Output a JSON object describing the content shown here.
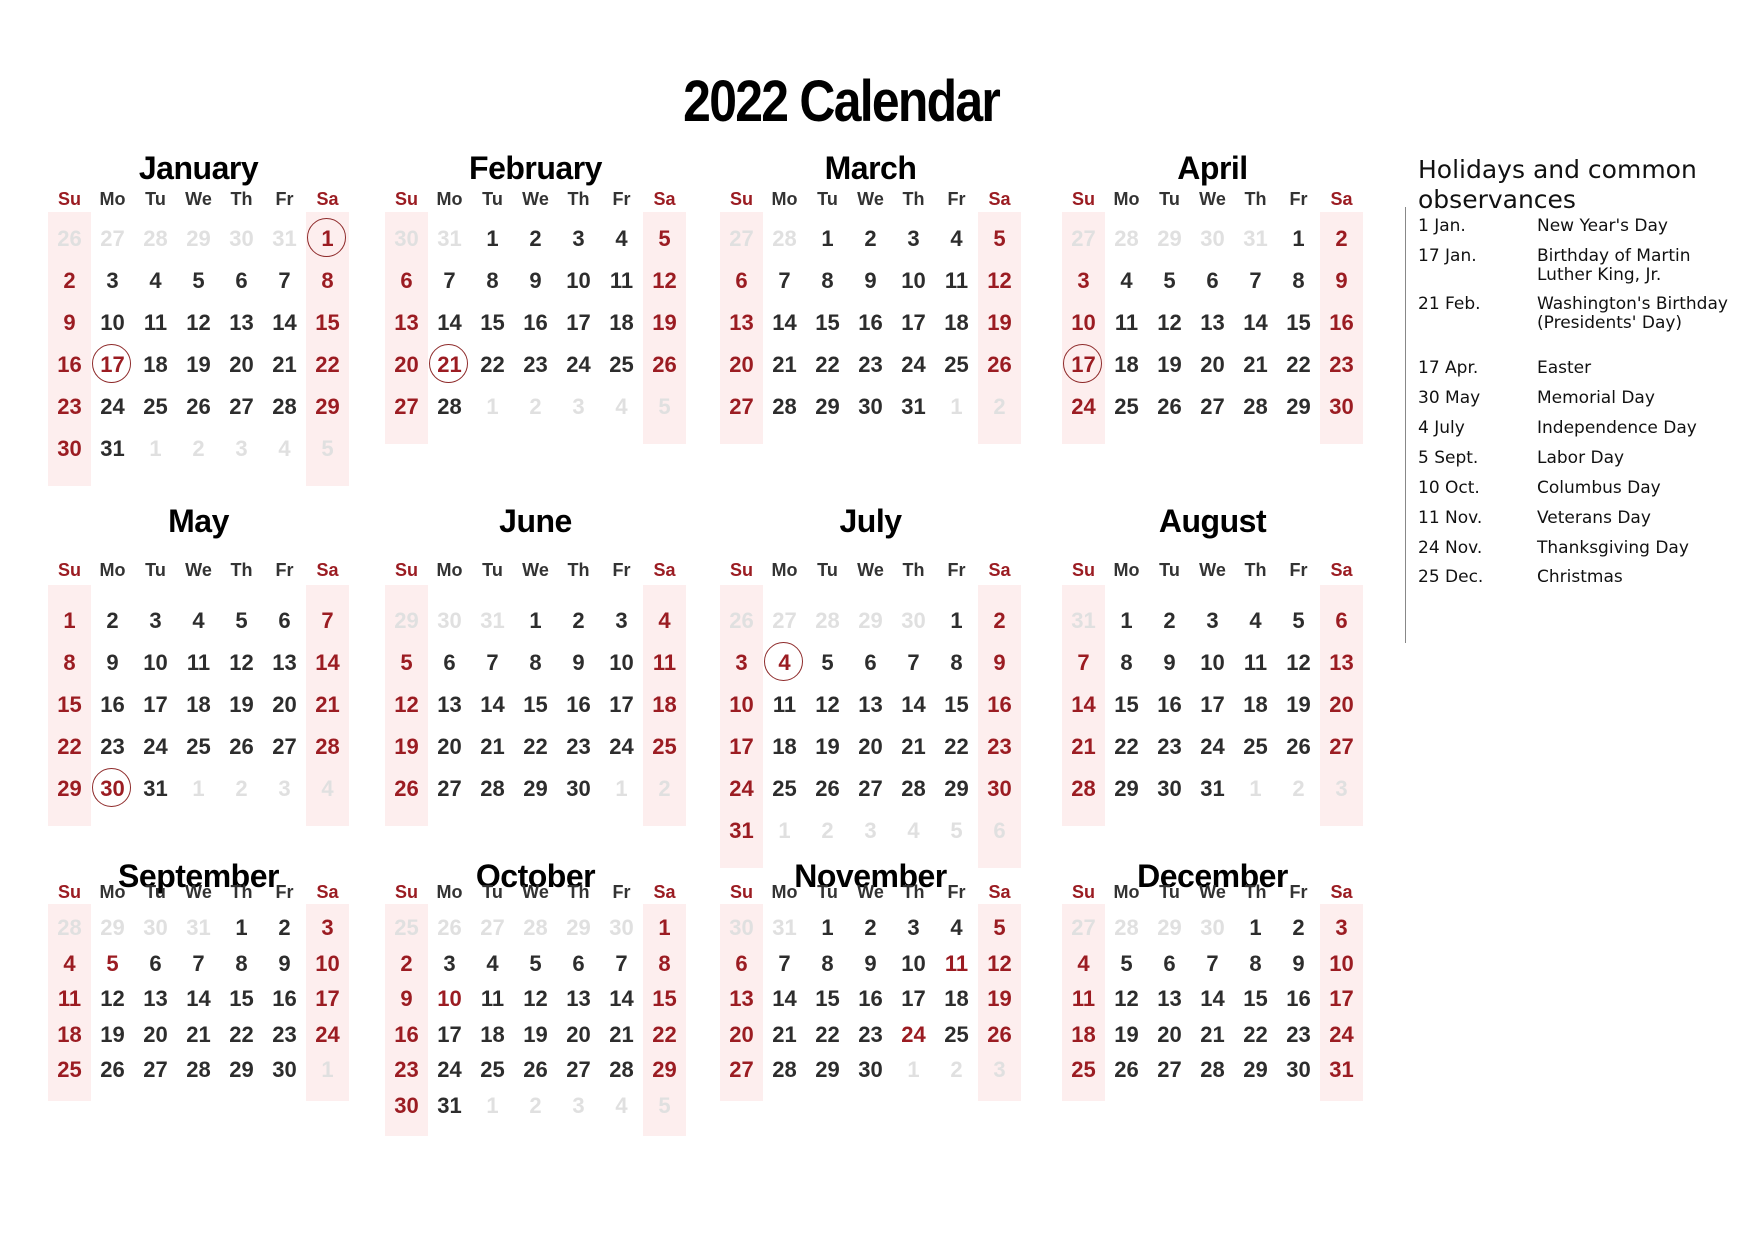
{
  "title": "2022 Calendar",
  "weekdays": [
    "Su",
    "Mo",
    "Tu",
    "We",
    "Th",
    "Fr",
    "Sa"
  ],
  "colors": {
    "weekend": "#9b1c22",
    "band": "#fdeeee",
    "other_month": "#e0e0e0",
    "text": "#2d2d2d"
  },
  "months": [
    {
      "name": "January",
      "lead": [
        26,
        27,
        28,
        29,
        30,
        31
      ],
      "days": 31,
      "trail": [
        1,
        2,
        3,
        4,
        5
      ],
      "circled": [
        1,
        17
      ],
      "holidays": [
        1,
        17
      ]
    },
    {
      "name": "February",
      "lead": [
        30,
        31
      ],
      "days": 28,
      "trail": [
        1,
        2,
        3,
        4,
        5
      ],
      "circled": [
        21
      ],
      "holidays": [
        21
      ]
    },
    {
      "name": "March",
      "lead": [
        27,
        28
      ],
      "days": 31,
      "trail": [
        1,
        2
      ],
      "circled": [],
      "holidays": []
    },
    {
      "name": "April",
      "lead": [
        27,
        28,
        29,
        30,
        31
      ],
      "days": 30,
      "trail": [],
      "circled": [
        17
      ],
      "holidays": [
        17
      ]
    },
    {
      "name": "May",
      "lead": [],
      "days": 31,
      "trail": [
        1,
        2,
        3,
        4
      ],
      "circled": [
        30
      ],
      "holidays": [
        30
      ]
    },
    {
      "name": "June",
      "lead": [
        29,
        30,
        31
      ],
      "days": 30,
      "trail": [
        1,
        2
      ],
      "circled": [],
      "holidays": []
    },
    {
      "name": "July",
      "lead": [
        26,
        27,
        28,
        29,
        30
      ],
      "days": 31,
      "trail": [
        1,
        2,
        3,
        4,
        5,
        6
      ],
      "circled": [
        4
      ],
      "holidays": [
        4
      ]
    },
    {
      "name": "August",
      "lead": [
        31
      ],
      "days": 31,
      "trail": [
        1,
        2,
        3
      ],
      "circled": [],
      "holidays": []
    },
    {
      "name": "September",
      "lead": [
        28,
        29,
        30,
        31
      ],
      "days": 30,
      "trail": [
        1
      ],
      "circled": [],
      "holidays": [
        5
      ]
    },
    {
      "name": "October",
      "lead": [
        25,
        26,
        27,
        28,
        29,
        30
      ],
      "days": 31,
      "trail": [
        1,
        2,
        3,
        4,
        5
      ],
      "circled": [],
      "holidays": [
        10
      ]
    },
    {
      "name": "November",
      "lead": [
        30,
        31
      ],
      "days": 30,
      "trail": [
        1,
        2,
        3
      ],
      "circled": [],
      "holidays": [
        11,
        24
      ]
    },
    {
      "name": "December",
      "lead": [
        27,
        28,
        29,
        30
      ],
      "days": 31,
      "trail": [],
      "circled": [],
      "holidays": []
    }
  ],
  "holidays_panel": {
    "heading": "Holidays and common observances",
    "items": [
      {
        "date": "1 Jan.",
        "name": "New Year's Day"
      },
      {
        "date": "17 Jan.",
        "name": "Birthday of Martin Luther King, Jr."
      },
      {
        "date": "21 Feb.",
        "name": "Washington's Birthday (Presidents' Day)"
      },
      {
        "date": "17 Apr.",
        "name": "Easter"
      },
      {
        "date": "30 May",
        "name": "Memorial Day"
      },
      {
        "date": "4 July",
        "name": "Independence Day"
      },
      {
        "date": "5 Sept.",
        "name": "Labor Day"
      },
      {
        "date": "10 Oct.",
        "name": "Columbus Day"
      },
      {
        "date": "11 Nov.",
        "name": "Veterans Day"
      },
      {
        "date": "24 Nov.",
        "name": "Thanksgiving Day"
      },
      {
        "date": "25 Dec.",
        "name": "Christmas"
      }
    ]
  }
}
